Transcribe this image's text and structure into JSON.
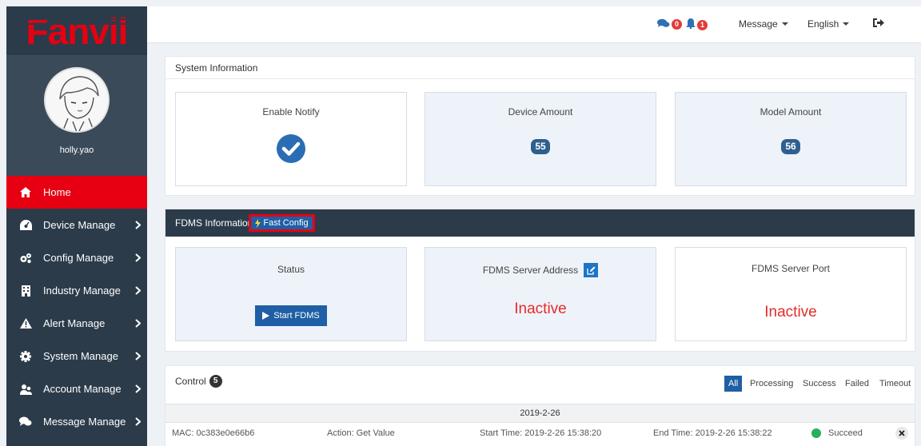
{
  "brand": {
    "logo_text": "Fanvil",
    "accent": "#e60012",
    "sidebar_bg": "#2c3b4a"
  },
  "user": {
    "name": "holly.yao"
  },
  "sidebar": {
    "items": [
      {
        "label": "Home",
        "icon": "home-icon",
        "active": true
      },
      {
        "label": "Device Manage",
        "icon": "dashboard-icon"
      },
      {
        "label": "Config Manage",
        "icon": "cogs-icon"
      },
      {
        "label": "Industry Manage",
        "icon": "building-icon"
      },
      {
        "label": "Alert Manage",
        "icon": "warning-icon"
      },
      {
        "label": "System Manage",
        "icon": "gear-icon"
      },
      {
        "label": "Account Manage",
        "icon": "users-icon"
      },
      {
        "label": "Message Manage",
        "icon": "comments-icon"
      }
    ]
  },
  "topbar": {
    "comments_count": "0",
    "alerts_count": "1",
    "message_label": "Message",
    "language_label": "English"
  },
  "system_info": {
    "title": "System Information",
    "enable_notify": "Enable Notify",
    "device_amount_label": "Device Amount",
    "device_amount": "55",
    "model_amount_label": "Model Amount",
    "model_amount": "56"
  },
  "fdms": {
    "title": "FDMS Information",
    "fast_config": "Fast Config",
    "status_label": "Status",
    "start_button": "Start FDMS",
    "server_address_label": "FDMS Server Address",
    "server_address_value": "Inactive",
    "server_port_label": "FDMS Server Port",
    "server_port_value": "Inactive"
  },
  "control": {
    "title": "Control",
    "count": "5",
    "filters": [
      "All",
      "Processing",
      "Success",
      "Failed",
      "Timeout"
    ],
    "date": "2019-2-26",
    "rows": [
      {
        "mac": "MAC: 0c383e0e66b6",
        "action": "Action: Get Value",
        "start": "Start Time: 2019-2-26 15:38:20",
        "end": "End Time: 2019-2-26 15:38:22",
        "status": "Succeed",
        "status_color": "#27ae60"
      }
    ]
  }
}
